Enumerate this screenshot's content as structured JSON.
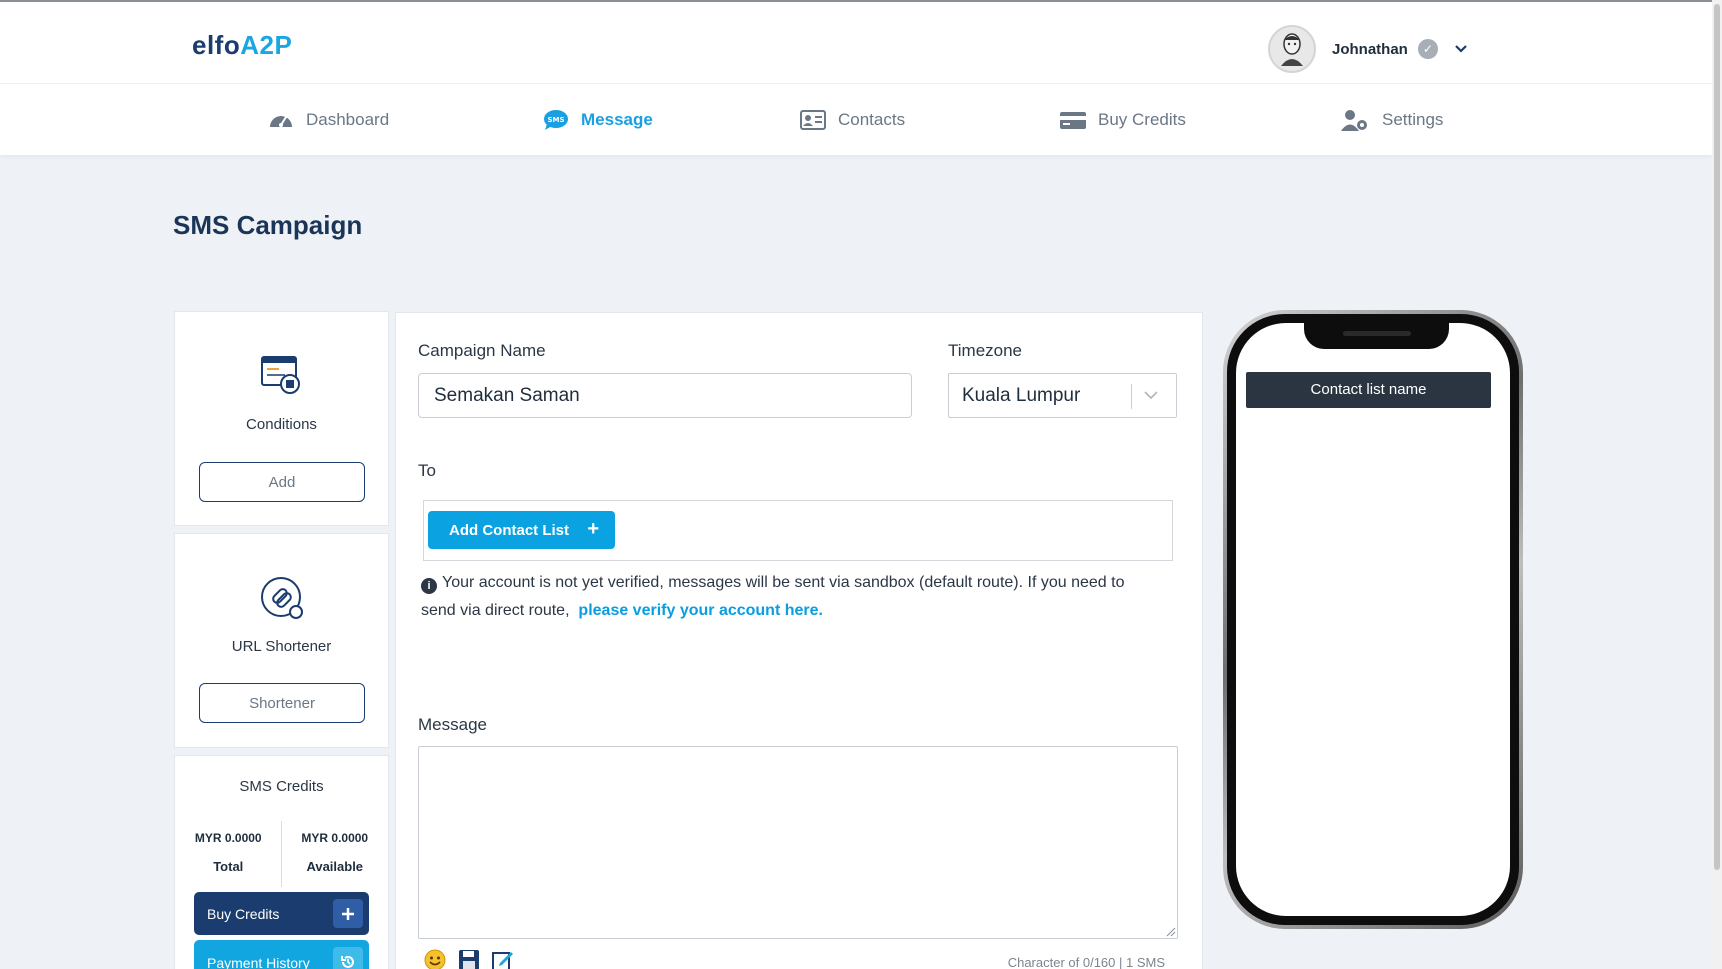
{
  "app": {
    "logo_main": "elfo",
    "logo_accent": "A2P"
  },
  "user": {
    "name": "Johnathan"
  },
  "nav": {
    "items": [
      {
        "label": "Dashboard",
        "icon": "dashboard-gauge-icon"
      },
      {
        "label": "Message",
        "icon": "sms-bubble-icon",
        "active": true
      },
      {
        "label": "Contacts",
        "icon": "contact-card-icon"
      },
      {
        "label": "Buy Credits",
        "icon": "credit-card-icon"
      },
      {
        "label": "Settings",
        "icon": "user-gear-icon"
      }
    ]
  },
  "page": {
    "title": "SMS Campaign"
  },
  "sidebar": {
    "conditions": {
      "label": "Conditions",
      "button": "Add"
    },
    "url_shortener": {
      "label": "URL Shortener",
      "button": "Shortener"
    },
    "credits": {
      "title": "SMS Credits",
      "total_amount": "MYR 0.0000",
      "total_label": "Total",
      "available_amount": "MYR 0.0000",
      "available_label": "Available",
      "buy_button": "Buy Credits",
      "history_button": "Payment History"
    }
  },
  "form": {
    "campaign_name_label": "Campaign Name",
    "campaign_name_value": "Semakan Saman",
    "timezone_label": "Timezone",
    "timezone_value": "Kuala Lumpur",
    "to_label": "To",
    "add_contact_button": "Add Contact List",
    "notice_text": "Your account is not yet verified, messages will be sent via sandbox (default route). If you need to send via direct route,",
    "notice_link": "please verify your account here.",
    "message_label": "Message",
    "char_count": "Character of 0/160 | 1 SMS"
  },
  "preview": {
    "contact_list_name": "Contact list name"
  },
  "colors": {
    "brand_dark": "#1b3c6e",
    "brand_blue": "#0aa2e0",
    "phone_header": "#2b3542"
  }
}
